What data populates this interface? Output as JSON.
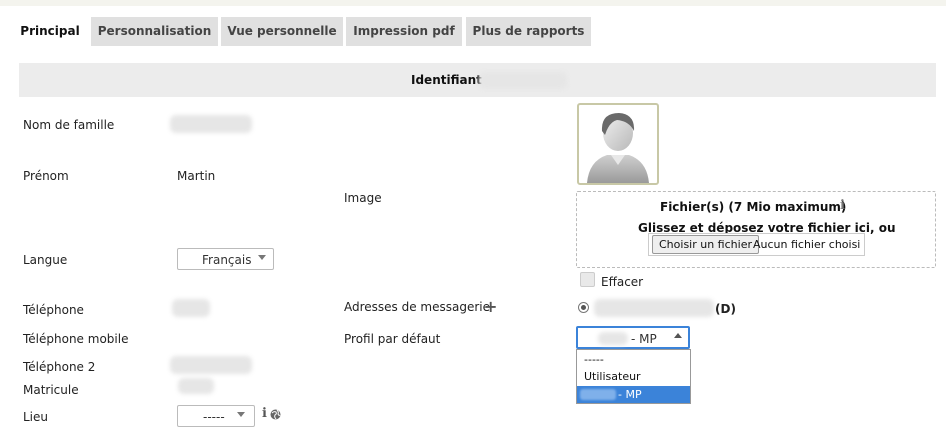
{
  "tabs": [
    {
      "label": "Principal",
      "active": true
    },
    {
      "label": "Personnalisation",
      "active": false
    },
    {
      "label": "Vue personnelle",
      "active": false
    },
    {
      "label": "Impression pdf",
      "active": false
    },
    {
      "label": "Plus de rapports",
      "active": false
    }
  ],
  "identifiant": {
    "label": "Identifiant :"
  },
  "fields": {
    "nom_famille": "Nom de famille",
    "prenom": "Prénom",
    "prenom_value": "Martin",
    "langue": "Langue",
    "langue_value": "Français",
    "telephone": "Téléphone",
    "telephone_mobile": "Téléphone mobile",
    "telephone_2": "Téléphone 2",
    "matricule": "Matricule",
    "lieu": "Lieu",
    "lieu_value": "-----",
    "image": "Image",
    "adresses": "Adresses de messagerie",
    "adresses_suffix": "(D)",
    "profil": "Profil par défaut",
    "profil_value": "- MP"
  },
  "upload": {
    "title": "Fichier(s) (7 Mio maximum)",
    "hint": "Glissez et déposez votre fichier ici, ou",
    "button": "Choisir un fichier",
    "no_file": "Aucun fichier choisi",
    "delete_label": "Effacer"
  },
  "profil_options": [
    "-----",
    "Utilisateur",
    "- MP"
  ],
  "icons": {
    "info": "info-icon",
    "globe": "globe-icon",
    "add": "plus-icon",
    "avatar": "user-avatar-icon"
  }
}
